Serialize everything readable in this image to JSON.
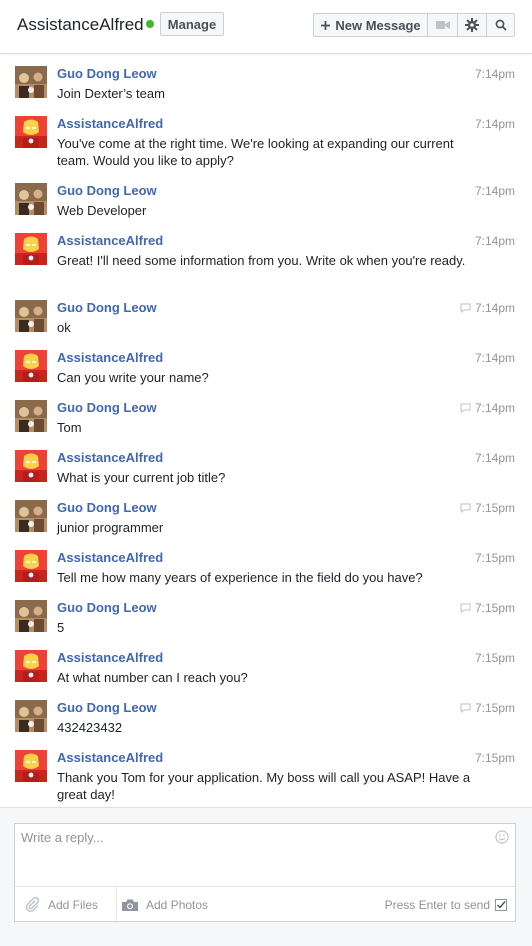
{
  "header": {
    "title": "AssistanceAlfred",
    "manage_label": "Manage",
    "new_message_label": "New Message",
    "status_color": "#42b72a"
  },
  "messages": [
    {
      "sender": "Guo Dong Leow",
      "time": "7:14pm",
      "text": "Join Dexter’s team",
      "avatar": "user",
      "seen": false
    },
    {
      "sender": "AssistanceAlfred",
      "time": "7:14pm",
      "text": "You've come at the right time. We're looking at expanding our current team. Would you like to apply?",
      "avatar": "bot",
      "seen": false
    },
    {
      "sender": "Guo Dong Leow",
      "time": "7:14pm",
      "text": "Web Developer",
      "avatar": "user",
      "seen": false
    },
    {
      "sender": "AssistanceAlfred",
      "time": "7:14pm",
      "text": "Great! I'll need some information from you. Write ok when you're ready.",
      "avatar": "bot",
      "seen": false
    },
    {
      "sender": "Guo Dong Leow",
      "time": "7:14pm",
      "text": "ok",
      "avatar": "user",
      "seen": true
    },
    {
      "sender": "AssistanceAlfred",
      "time": "7:14pm",
      "text": "Can you write your name?",
      "avatar": "bot",
      "seen": false
    },
    {
      "sender": "Guo Dong Leow",
      "time": "7:14pm",
      "text": "Tom",
      "avatar": "user",
      "seen": true
    },
    {
      "sender": "AssistanceAlfred",
      "time": "7:14pm",
      "text": "What is your current job title?",
      "avatar": "bot",
      "seen": false
    },
    {
      "sender": "Guo Dong Leow",
      "time": "7:15pm",
      "text": "junior programmer",
      "avatar": "user",
      "seen": true
    },
    {
      "sender": "AssistanceAlfred",
      "time": "7:15pm",
      "text": "Tell me how many years of experience in the field do you have?",
      "avatar": "bot",
      "seen": false
    },
    {
      "sender": "Guo Dong Leow",
      "time": "7:15pm",
      "text": "5",
      "avatar": "user",
      "seen": true
    },
    {
      "sender": "AssistanceAlfred",
      "time": "7:15pm",
      "text": "At what number can I reach you?",
      "avatar": "bot",
      "seen": false
    },
    {
      "sender": "Guo Dong Leow",
      "time": "7:15pm",
      "text": "432423432",
      "avatar": "user",
      "seen": true
    },
    {
      "sender": "AssistanceAlfred",
      "time": "7:15pm",
      "text": "Thank you Tom for your application. My boss will call you ASAP! Have a great day!",
      "avatar": "bot",
      "seen": false
    }
  ],
  "composer": {
    "placeholder": "Write a reply...",
    "add_files_label": "Add Files",
    "add_photos_label": "Add Photos",
    "send_hint": "Press Enter to send",
    "enter_to_send_checked": true
  },
  "icons": {
    "new_message": "plus-icon",
    "video": "video-camera-icon",
    "settings": "gear-icon",
    "search": "search-icon",
    "seen": "chat-bubble-icon",
    "emoji": "emoji-icon",
    "files": "paperclip-icon",
    "photos": "camera-icon"
  },
  "colors": {
    "sender_name": "#4267b2",
    "secondary_text": "#90949c",
    "bot_avatar_bg": "#c8261c"
  }
}
